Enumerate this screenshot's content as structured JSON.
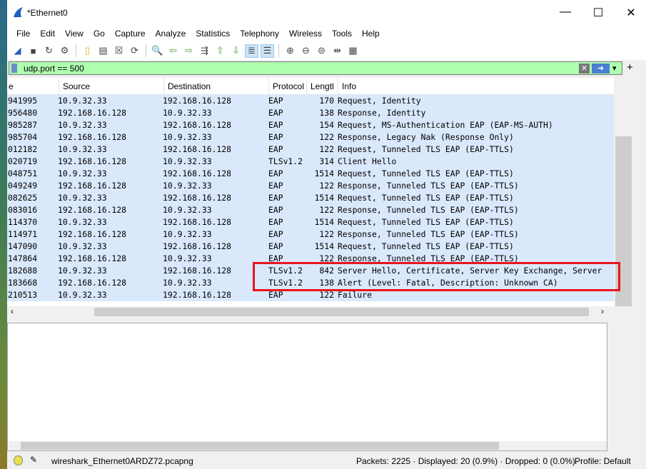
{
  "window": {
    "title": "*Ethernet0"
  },
  "menu": [
    "File",
    "Edit",
    "View",
    "Go",
    "Capture",
    "Analyze",
    "Statistics",
    "Telephony",
    "Wireless",
    "Tools",
    "Help"
  ],
  "toolbar": [
    "shark-fin-icon",
    "stop-icon",
    "restart-icon",
    "options-icon",
    "open-icon",
    "save-icon",
    "close-file-icon",
    "reload-icon",
    "find-icon",
    "back-icon",
    "forward-icon",
    "goto-icon",
    "first-icon",
    "last-icon",
    "autoscroll-icon",
    "colorize-icon",
    "zoom-in-icon",
    "zoom-out-icon",
    "normal-size-icon",
    "resize-columns-icon",
    "layout-icon"
  ],
  "filter": {
    "value": "udp.port == 500"
  },
  "columns": [
    "e",
    "Source",
    "Destination",
    "Protocol",
    "Lengtl",
    "Info"
  ],
  "rows": [
    [
      "941995",
      "10.9.32.33",
      "192.168.16.128",
      "EAP",
      "170",
      "Request, Identity"
    ],
    [
      "956480",
      "192.168.16.128",
      "10.9.32.33",
      "EAP",
      "138",
      "Response, Identity"
    ],
    [
      "985287",
      "10.9.32.33",
      "192.168.16.128",
      "EAP",
      "154",
      "Request, MS-Authentication EAP (EAP-MS-AUTH)"
    ],
    [
      "985704",
      "192.168.16.128",
      "10.9.32.33",
      "EAP",
      "122",
      "Response, Legacy Nak (Response Only)"
    ],
    [
      "012182",
      "10.9.32.33",
      "192.168.16.128",
      "EAP",
      "122",
      "Request, Tunneled TLS EAP (EAP-TTLS)"
    ],
    [
      "020719",
      "192.168.16.128",
      "10.9.32.33",
      "TLSv1.2",
      "314",
      "Client Hello"
    ],
    [
      "048751",
      "10.9.32.33",
      "192.168.16.128",
      "EAP",
      "1514",
      "Request, Tunneled TLS EAP (EAP-TTLS)"
    ],
    [
      "049249",
      "192.168.16.128",
      "10.9.32.33",
      "EAP",
      "122",
      "Response, Tunneled TLS EAP (EAP-TTLS)"
    ],
    [
      "082625",
      "10.9.32.33",
      "192.168.16.128",
      "EAP",
      "1514",
      "Request, Tunneled TLS EAP (EAP-TTLS)"
    ],
    [
      "083016",
      "192.168.16.128",
      "10.9.32.33",
      "EAP",
      "122",
      "Response, Tunneled TLS EAP (EAP-TTLS)"
    ],
    [
      "114370",
      "10.9.32.33",
      "192.168.16.128",
      "EAP",
      "1514",
      "Request, Tunneled TLS EAP (EAP-TTLS)"
    ],
    [
      "114971",
      "192.168.16.128",
      "10.9.32.33",
      "EAP",
      "122",
      "Response, Tunneled TLS EAP (EAP-TTLS)"
    ],
    [
      "147090",
      "10.9.32.33",
      "192.168.16.128",
      "EAP",
      "1514",
      "Request, Tunneled TLS EAP (EAP-TTLS)"
    ],
    [
      "147864",
      "192.168.16.128",
      "10.9.32.33",
      "EAP",
      "122",
      "Response, Tunneled TLS EAP (EAP-TTLS)"
    ],
    [
      "182688",
      "10.9.32.33",
      "192.168.16.128",
      "TLSv1.2",
      "842",
      "Server Hello, Certificate, Server Key Exchange, Server"
    ],
    [
      "183668",
      "192.168.16.128",
      "10.9.32.33",
      "TLSv1.2",
      "138",
      "Alert (Level: Fatal, Description: Unknown CA)"
    ],
    [
      "210513",
      "10.9.32.33",
      "192.168.16.128",
      "EAP",
      "122",
      "Failure"
    ]
  ],
  "status": {
    "file": "wireshark_Ethernet0ARDZ72.pcapng",
    "packets": "Packets: 2225 · Displayed: 20 (0.9%) · Dropped: 0 (0.0%)",
    "profile": "Profile: Default"
  },
  "colors": {
    "row_bg": "#dae8fc",
    "filter_bg": "#afffaf",
    "highlight": "#e8141c"
  }
}
